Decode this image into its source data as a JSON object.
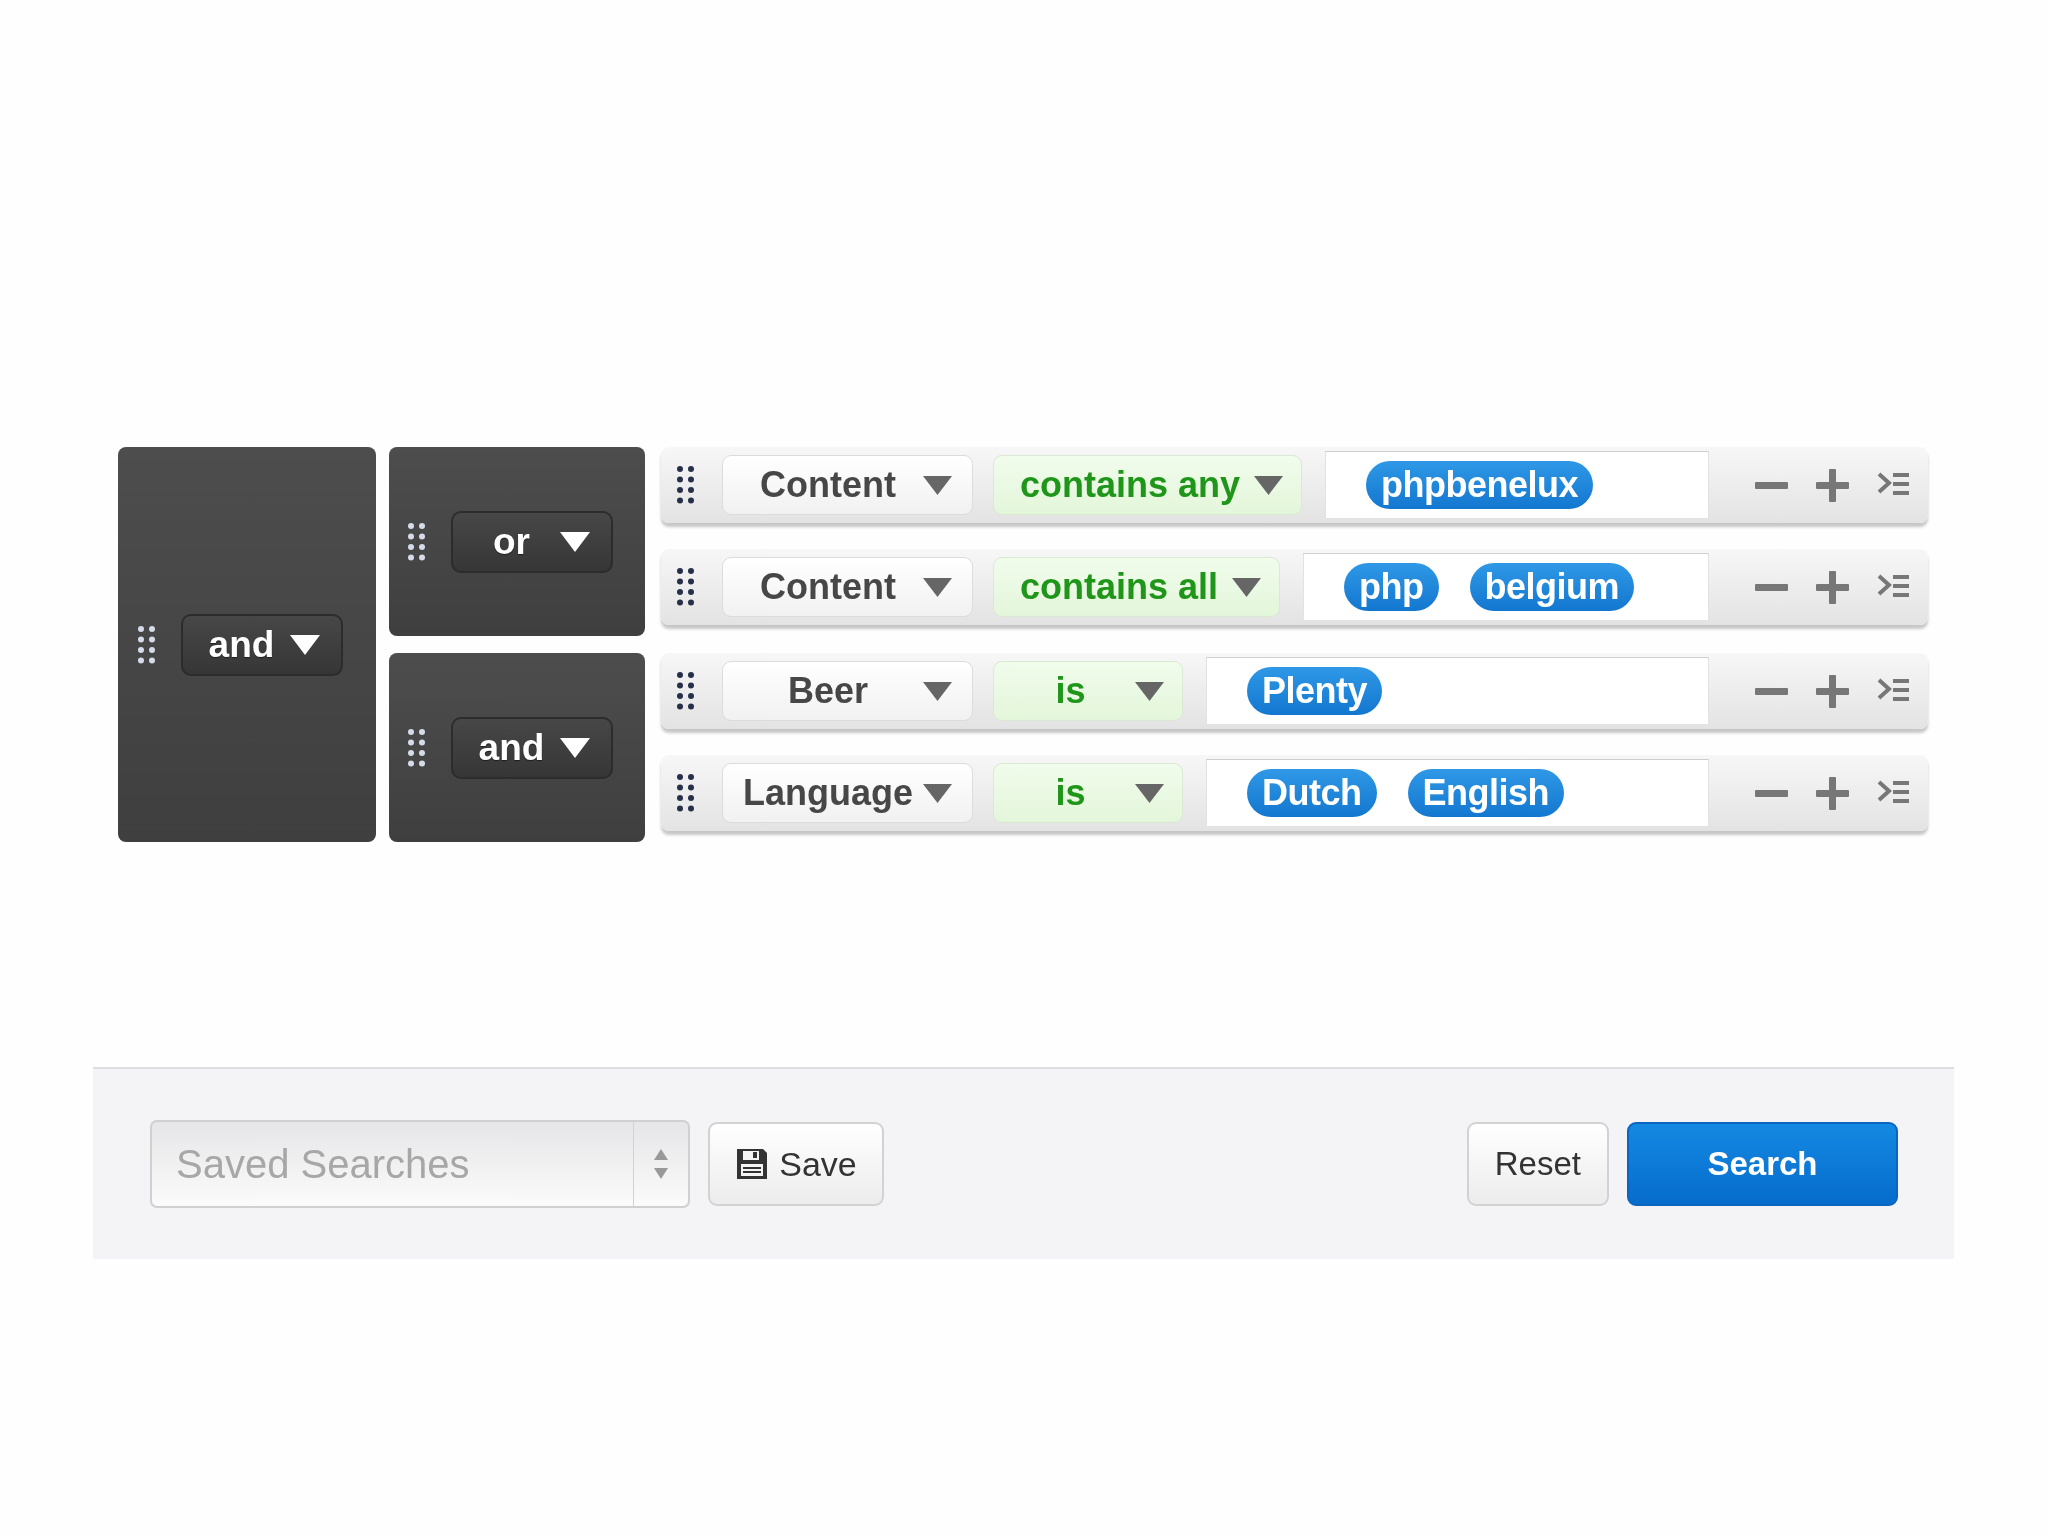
{
  "query": {
    "operator": "and",
    "groups": [
      {
        "operator": "or",
        "rules": [
          {
            "field": "Content",
            "operator": "contains any",
            "values": [
              "phpbenelux"
            ]
          },
          {
            "field": "Content",
            "operator": "contains all",
            "values": [
              "php",
              "belgium"
            ]
          }
        ]
      },
      {
        "operator": "and",
        "rules": [
          {
            "field": "Beer",
            "operator": "is",
            "values": [
              "Plenty"
            ]
          },
          {
            "field": "Language",
            "operator": "is",
            "values": [
              "Dutch",
              "English"
            ]
          }
        ]
      }
    ]
  },
  "footer": {
    "saved_searches": {
      "placeholder": "Saved Searches"
    },
    "save_button": {
      "label": "Save"
    },
    "buttons": [
      {
        "label": "Reset",
        "kind": "default"
      },
      {
        "label": "Search",
        "kind": "primary"
      }
    ]
  }
}
